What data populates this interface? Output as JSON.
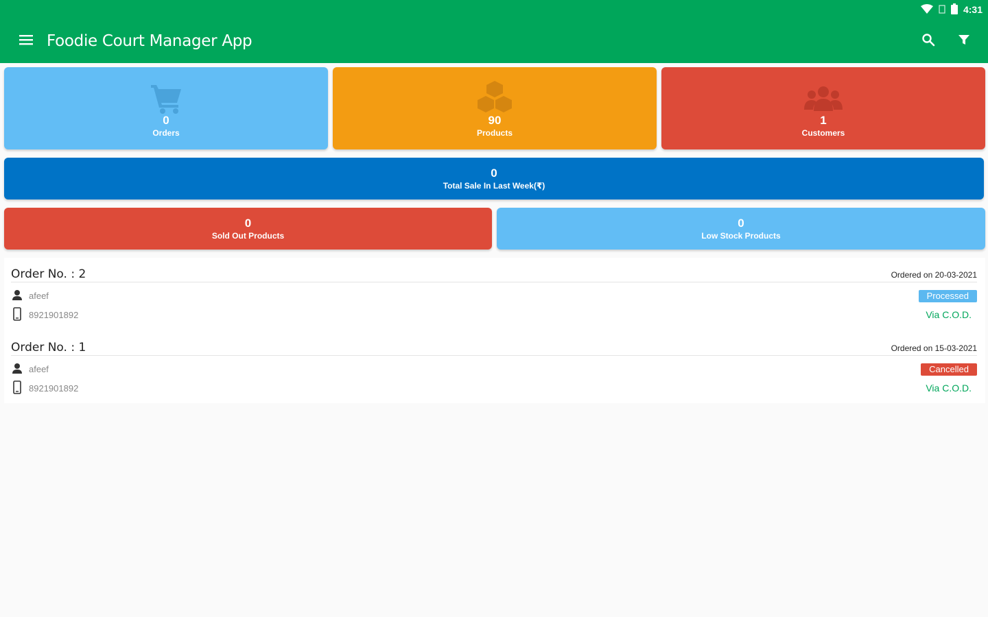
{
  "status_bar": {
    "time": "4:31"
  },
  "app_bar": {
    "title": "Foodie Court Manager App"
  },
  "stats": {
    "orders": {
      "value": "0",
      "label": "Orders"
    },
    "products": {
      "value": "90",
      "label": "Products"
    },
    "customers": {
      "value": "1",
      "label": "Customers"
    },
    "total_sale": {
      "value": "0",
      "label": "Total Sale In Last Week(₹)"
    },
    "sold_out": {
      "value": "0",
      "label": "Sold Out Products"
    },
    "low_stock": {
      "value": "0",
      "label": "Low Stock Products"
    }
  },
  "orders": [
    {
      "title": "Order No. : 2",
      "date": "Ordered on 20-03-2021",
      "customer": "afeef",
      "phone": "8921901892",
      "status": "Processed",
      "status_color": "#5bb8f0",
      "payment": "Via C.O.D."
    },
    {
      "title": "Order No. : 1",
      "date": "Ordered on 15-03-2021",
      "customer": "afeef",
      "phone": "8921901892",
      "status": "Cancelled",
      "status_color": "#dd4b39",
      "payment": "Via C.O.D."
    }
  ],
  "colors": {
    "app_bar": "#00a65a",
    "orders_tile": "#62bdf5",
    "products_tile": "#f39c12",
    "customers_tile": "#dd4b39",
    "total_sale_tile": "#0073c6",
    "sold_out_tile": "#dd4b39",
    "low_stock_tile": "#62bdf5"
  },
  "icons": [
    "menu-icon",
    "search-icon",
    "filter-icon",
    "cart-icon",
    "cubes-icon",
    "users-icon",
    "user-icon",
    "phone-icon",
    "wifi-icon",
    "battery-icon"
  ]
}
